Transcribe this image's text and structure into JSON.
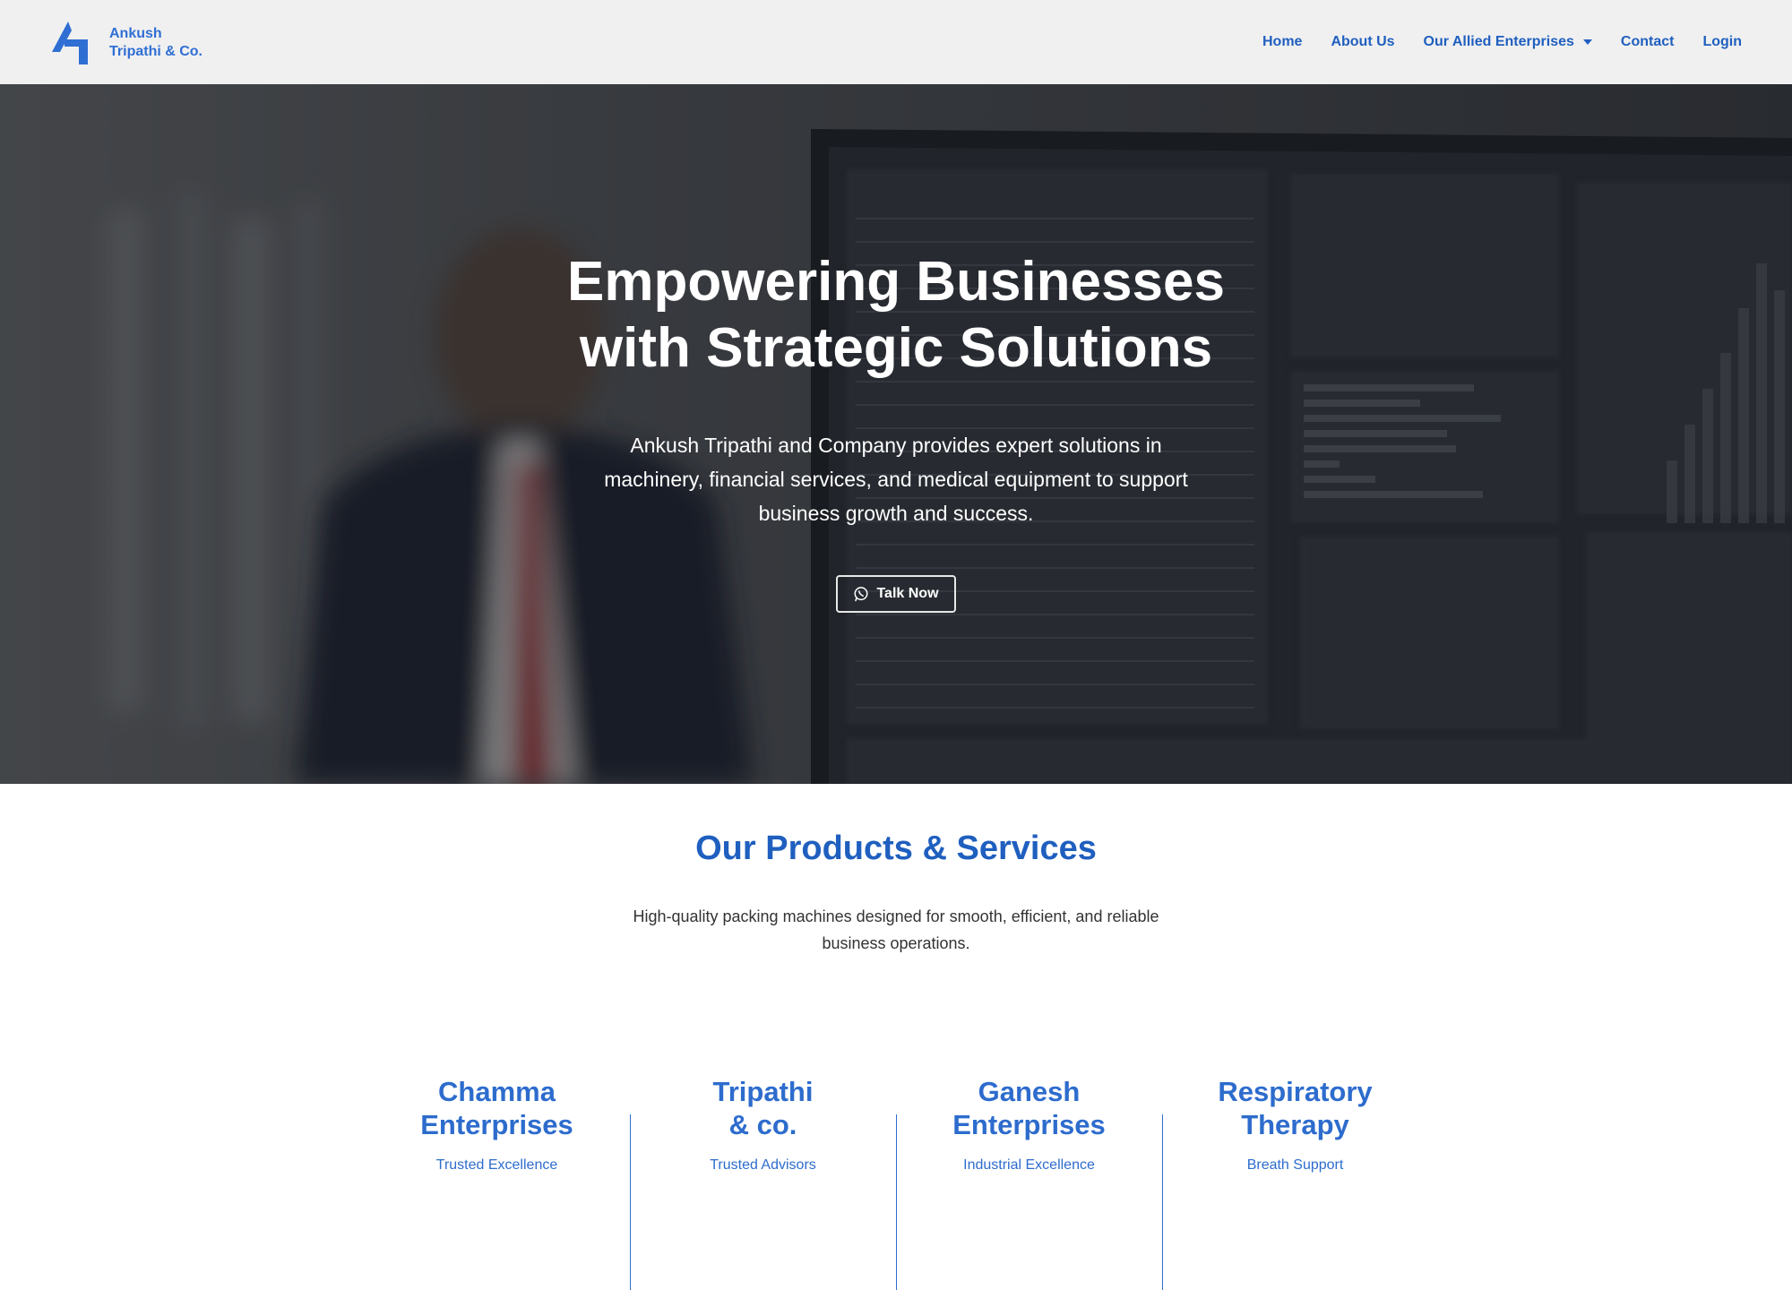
{
  "brand": {
    "name_line1": "Ankush",
    "name_line2": "Tripathi & Co.",
    "logo_icon": "brand-logo-icon",
    "color": "#2f6fd4"
  },
  "nav": {
    "items": [
      {
        "label": "Home"
      },
      {
        "label": "About Us"
      },
      {
        "label": "Our Allied Enterprises",
        "has_dropdown": true
      },
      {
        "label": "Contact"
      },
      {
        "label": "Login"
      }
    ],
    "color": "#1f5fbf"
  },
  "hero": {
    "title_line1": "Empowering Businesses",
    "title_line2": "with Strategic Solutions",
    "subtitle_line1": "Ankush Tripathi and Company provides expert solutions in",
    "subtitle_line2": "machinery, financial services, and medical equipment to support",
    "subtitle_line3": "business growth and success.",
    "cta_label": "Talk Now",
    "cta_icon": "whatsapp-icon"
  },
  "products": {
    "title": "Our Products & Services",
    "subtitle_line1": "High-quality packing machines designed for smooth, efficient, and reliable",
    "subtitle_line2": "business operations.",
    "cards": [
      {
        "title_line1": "Chamma",
        "title_line2": "Enterprises",
        "tagline": "Trusted Excellence"
      },
      {
        "title_line1": "Tripathi",
        "title_line2": "& co.",
        "tagline": "Trusted Advisors"
      },
      {
        "title_line1": "Ganesh",
        "title_line2": "Enterprises",
        "tagline": "Industrial Excellence"
      },
      {
        "title_line1": "Respiratory",
        "title_line2": "Therapy",
        "tagline": "Breath Support"
      }
    ],
    "accent": "#2d6ccd"
  }
}
